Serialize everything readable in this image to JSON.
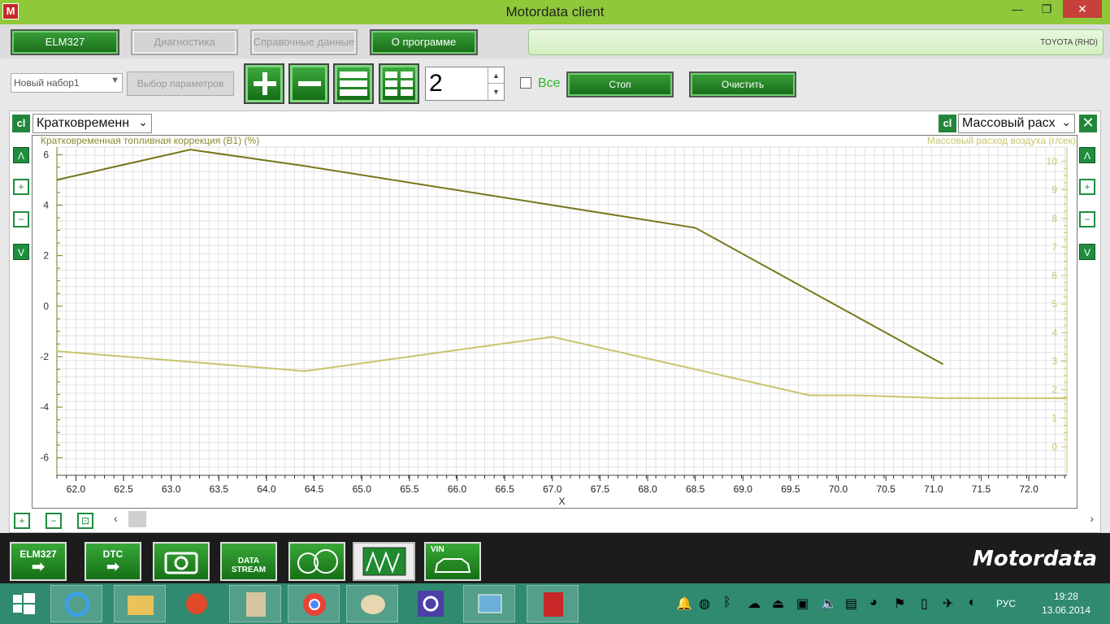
{
  "window": {
    "title": "Motordata client",
    "app_icon": "M",
    "minimize": "—",
    "maximize": "❐",
    "close": "✕"
  },
  "menu": {
    "tabs": [
      {
        "label": "ELM327",
        "enabled": true
      },
      {
        "label": "Диагностика",
        "enabled": false
      },
      {
        "label": "Справочные данные",
        "enabled": false
      },
      {
        "label": "О программе",
        "enabled": true
      }
    ],
    "vehicle": "TOYOTA (RHD)"
  },
  "toolbar": {
    "set_select": "Новый набор1",
    "param_button": "Выбор параметров",
    "plot_count": "2",
    "all_label": "Все",
    "all_checked": false,
    "stop_label": "Стоп",
    "clear_label": "Очистить"
  },
  "chart_header": {
    "left_cl": "cl",
    "right_cl": "cl",
    "left_param": "Кратковременн",
    "right_param": "Массовый расх",
    "close": "✕"
  },
  "chart_data": {
    "type": "line",
    "xlabel": "X",
    "xlim": [
      61.8,
      72.4
    ],
    "x_ticks": [
      "62.0",
      "62.5",
      "63.0",
      "63.5",
      "64.0",
      "64.5",
      "65.0",
      "65.5",
      "66.0",
      "66.5",
      "67.0",
      "67.5",
      "68.0",
      "68.5",
      "69.0",
      "69.5",
      "70.0",
      "70.5",
      "71.0",
      "71.5",
      "72.0"
    ],
    "left_axis": {
      "label": "Кратковременная топливная коррекция (B1)   (%)",
      "ylim": [
        -6.7,
        6.3
      ],
      "ticks": [
        "6",
        "4",
        "2",
        "0",
        "-2",
        "-4",
        "-6"
      ],
      "color": "#7a7a18"
    },
    "right_axis": {
      "label": "Массовый расход воздуха   (г/сек)",
      "ylim": [
        -1,
        10.5
      ],
      "ticks": [
        "10",
        "9",
        "8",
        "7",
        "6",
        "5",
        "4",
        "3",
        "2",
        "1",
        "0"
      ],
      "color": "#c8c46c"
    },
    "grid": true,
    "series": [
      {
        "axis": "left",
        "color": "#76761c",
        "x": [
          61.8,
          63.2,
          64.4,
          67.0,
          68.5,
          71.1
        ],
        "y": [
          5.0,
          6.2,
          5.55,
          4.0,
          3.1,
          -2.3
        ]
      },
      {
        "axis": "right",
        "color": "#c8c46c",
        "x": [
          61.8,
          64.4,
          67.0,
          69.7,
          70.2,
          71.1,
          72.4
        ],
        "y": [
          3.35,
          2.65,
          3.85,
          1.8,
          1.8,
          1.7,
          1.7
        ]
      }
    ]
  },
  "bottom_nav": {
    "items": [
      {
        "label": "ELM327"
      },
      {
        "label": "DTC"
      },
      {
        "label": ""
      },
      {
        "label": "DATA STREAM"
      },
      {
        "label": ""
      },
      {
        "label": ""
      },
      {
        "label": "VIN"
      }
    ],
    "brand": "Motordata"
  },
  "taskbar": {
    "lang": "РУС",
    "time": "19:28",
    "date": "13.06.2014"
  }
}
